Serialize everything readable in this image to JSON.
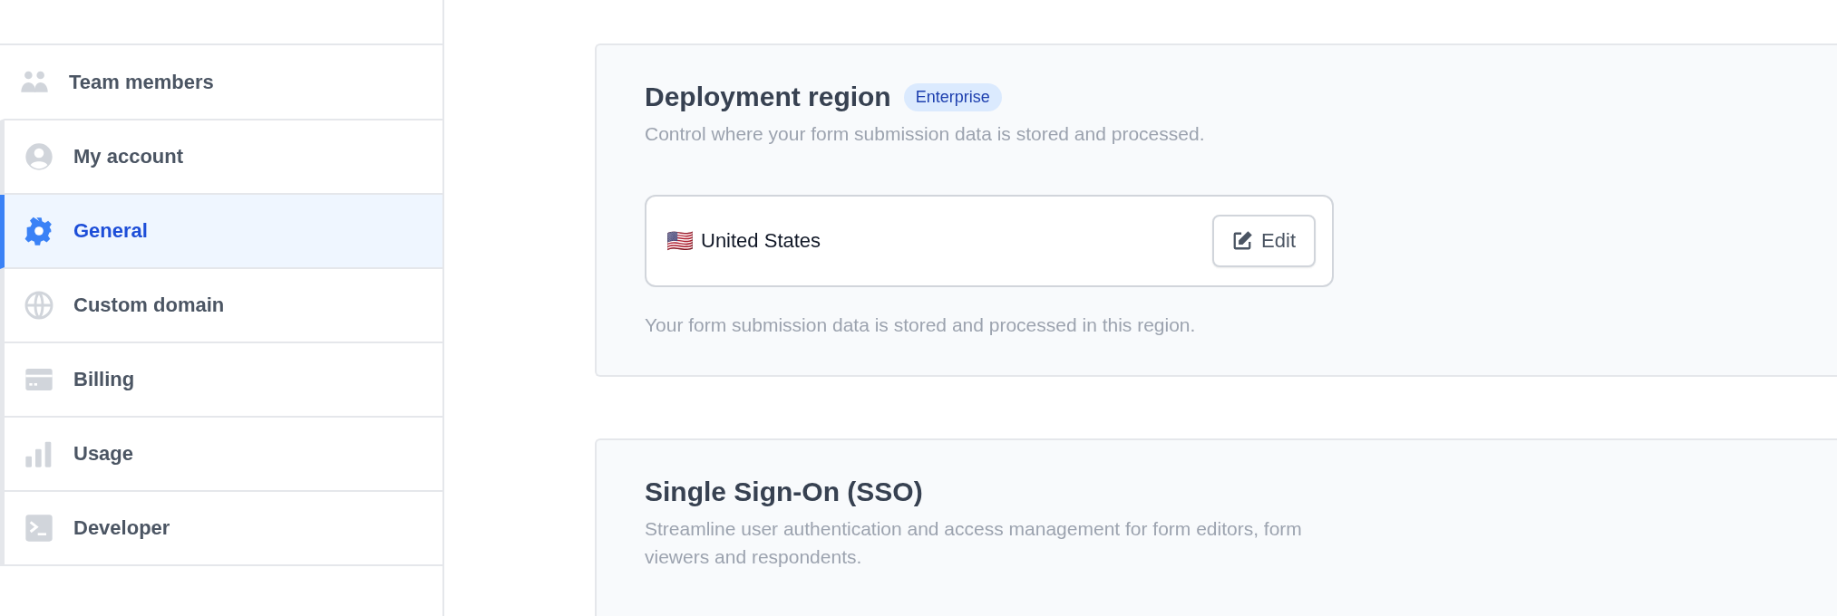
{
  "sidebar": {
    "top_item": {
      "label": "Team members"
    },
    "items": [
      {
        "label": "My account",
        "selected": false
      },
      {
        "label": "General",
        "selected": true
      },
      {
        "label": "Custom domain",
        "selected": false
      },
      {
        "label": "Billing",
        "selected": false
      },
      {
        "label": "Usage",
        "selected": false
      },
      {
        "label": "Developer",
        "selected": false
      }
    ]
  },
  "sections": [
    {
      "title": "Deployment region",
      "badge": "Enterprise",
      "description": "Control where your form submission data is stored and processed.",
      "region": {
        "flag": "🇺🇸",
        "name": "United States",
        "button": "Edit"
      },
      "note": "Your form submission data is stored and processed in this region."
    },
    {
      "title": "Single Sign-On (SSO)",
      "description": "Streamline user authentication and access management for form editors, form viewers and respondents."
    }
  ]
}
